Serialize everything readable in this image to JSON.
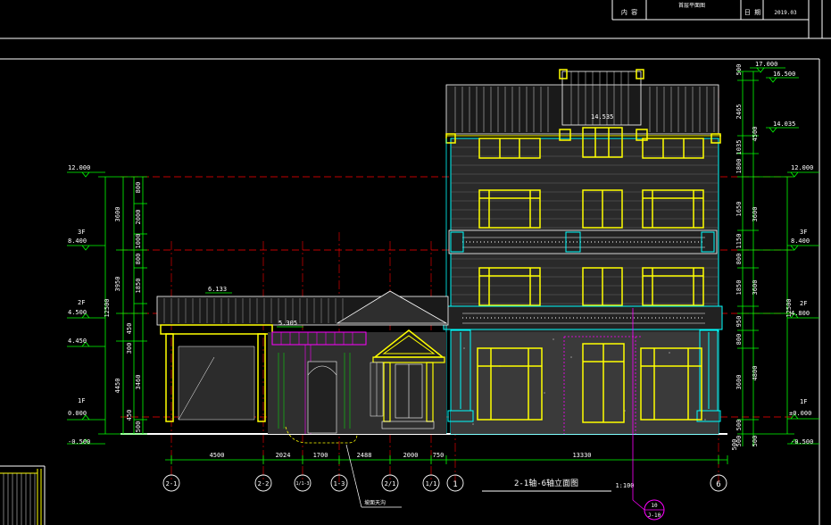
{
  "title_block": {
    "label_a": "内 容",
    "label_b": "首层平面图",
    "label_c": "日 期",
    "label_d": "2019.03"
  },
  "elevation_labels_left": [
    {
      "value": "12.000"
    },
    {
      "value": "3F"
    },
    {
      "value": "8.400"
    },
    {
      "value": "2F"
    },
    {
      "value": "4.500"
    },
    {
      "value": "4.450"
    },
    {
      "value": "1F"
    },
    {
      "value": "0.000"
    },
    {
      "value": "-0.500"
    }
  ],
  "elevation_labels_right": [
    {
      "value": "17.000"
    },
    {
      "value": "16.500"
    },
    {
      "value": "14.035"
    },
    {
      "value": "12.000"
    },
    {
      "value": "3F"
    },
    {
      "value": "8.400"
    },
    {
      "value": "2F"
    },
    {
      "value": "4.800"
    },
    {
      "value": "1F"
    },
    {
      "value": "±0.000"
    },
    {
      "value": "-0.500"
    }
  ],
  "roof_labels": {
    "roof_main": "14.535",
    "roof_left": "6.133",
    "roof_porch": "5.305"
  },
  "left_dims": {
    "total": "12500",
    "sub_a": "3600",
    "sub_b": "3950",
    "sub_c": "4450",
    "fine": [
      "800",
      "2000",
      "1000",
      "800",
      "1850",
      "450",
      "300",
      "3460",
      "450",
      "500"
    ]
  },
  "right_dims": {
    "total": "12500",
    "sub": [
      "500",
      "2465",
      "4500",
      "1035",
      "1800",
      "3600",
      "3600",
      "4800",
      "500",
      "500"
    ],
    "fine": [
      "1650",
      "1150",
      "1850",
      "800",
      "950",
      "3600",
      "800",
      "500"
    ]
  },
  "bottom_dims": [
    "4500",
    "2024",
    "1700",
    "2488",
    "2000",
    "750",
    "13330",
    "500"
  ],
  "axes": [
    {
      "label": "2-1"
    },
    {
      "label": "2-2"
    },
    {
      "label": "1/1-3"
    },
    {
      "label": "1-3"
    },
    {
      "label": "2/1"
    },
    {
      "label": "1/1"
    },
    {
      "label": "1"
    },
    {
      "label": "6"
    }
  ],
  "drawing_title": "2-1轴-6轴立面图",
  "scale": "1:100",
  "detail_ref": {
    "top": "10",
    "bottom": "J-10"
  },
  "note_label": "坡面天沟"
}
